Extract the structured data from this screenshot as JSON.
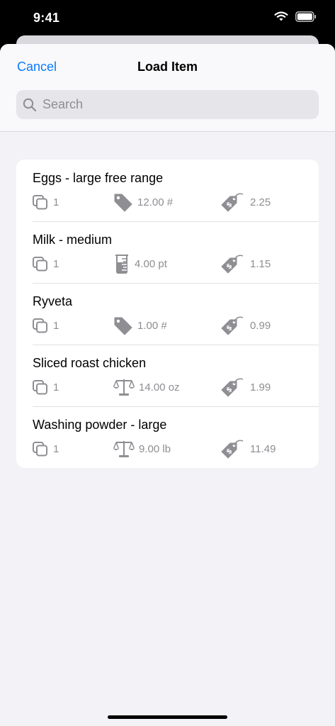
{
  "status_bar": {
    "time": "9:41"
  },
  "nav": {
    "cancel_label": "Cancel",
    "title": "Load Item"
  },
  "search": {
    "placeholder": "Search",
    "value": ""
  },
  "items": [
    {
      "name": "Eggs - large free range",
      "qty": "1",
      "size_icon": "tag-icon",
      "size": "12.00 #",
      "price": "2.25"
    },
    {
      "name": "Milk - medium",
      "qty": "1",
      "size_icon": "beaker-icon",
      "size": "4.00 pt",
      "price": "1.15"
    },
    {
      "name": "Ryveta",
      "qty": "1",
      "size_icon": "tag-icon",
      "size": "1.00 #",
      "price": "0.99"
    },
    {
      "name": "Sliced roast chicken",
      "qty": "1",
      "size_icon": "scale-icon",
      "size": "14.00 oz",
      "price": "1.99"
    },
    {
      "name": "Washing powder - large",
      "qty": "1",
      "size_icon": "scale-icon",
      "size": "9.00 lb",
      "price": "11.49"
    }
  ],
  "colors": {
    "accent": "#0a7aff",
    "secondary_text": "#8e8e93",
    "background": "#f2f2f7"
  }
}
